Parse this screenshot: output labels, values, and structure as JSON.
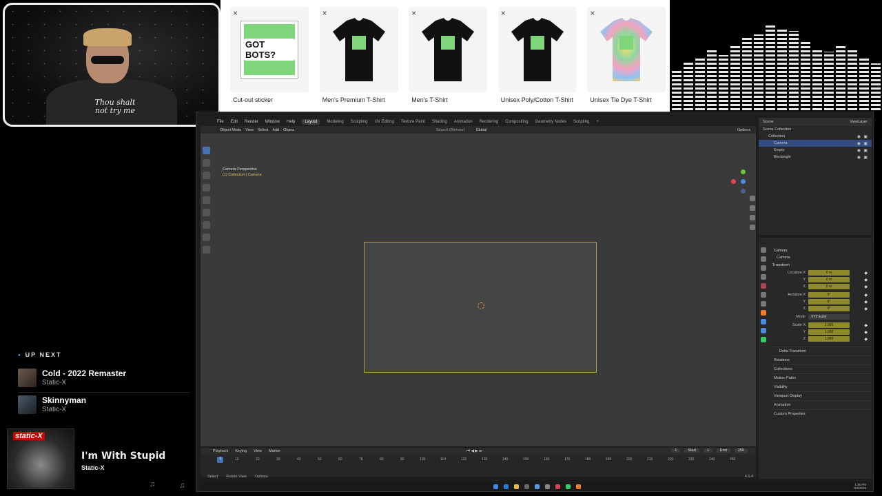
{
  "webcam": {
    "shirt_text": "Thou shalt not try me"
  },
  "merch": {
    "close_label": "×",
    "items": [
      {
        "label": "Cut-out sticker",
        "graphic_text": "GOT BOTS?",
        "kind": "sticker"
      },
      {
        "label": "Men's Premium T-Shirt",
        "kind": "tshirt-black"
      },
      {
        "label": "Men's T-Shirt",
        "kind": "tshirt-black"
      },
      {
        "label": "Unisex Poly/Cotton T-Shirt",
        "kind": "tshirt-black"
      },
      {
        "label": "Unisex Tie Dye T-Shirt",
        "kind": "tshirt-tiedye"
      }
    ],
    "colors": {
      "logo_green": "#7fd67a"
    }
  },
  "music": {
    "up_next_heading": "UP NEXT",
    "queue": [
      {
        "title": "Cold - 2022 Remaster",
        "artist": "Static-X"
      },
      {
        "title": "Skinnyman",
        "artist": "Static-X"
      }
    ],
    "now_playing": {
      "title": "I'm With Stupid",
      "artist": "Static-X",
      "logo": "static-X"
    },
    "note_icon": "♫"
  },
  "blender": {
    "menu": [
      "File",
      "Edit",
      "Render",
      "Window",
      "Help"
    ],
    "workspaces": [
      "Layout",
      "Modeling",
      "Sculpting",
      "UV Editing",
      "Texture Paint",
      "Shading",
      "Animation",
      "Rendering",
      "Compositing",
      "Geometry Nodes",
      "Scripting",
      "+"
    ],
    "active_workspace": "Layout",
    "header": {
      "mode": "Object Mode",
      "menus": [
        "View",
        "Select",
        "Add",
        "Object"
      ],
      "orientation": "Global",
      "search_placeholder": "Search (Blender)",
      "options": "Options"
    },
    "viewport": {
      "view_name": "Camera Perspective",
      "collection_path": "(1) Collection | Camera"
    },
    "timeline": {
      "menus": [
        "Playback",
        "Keying",
        "View",
        "Marker"
      ],
      "current_frame": "1",
      "ticks": [
        "10",
        "20",
        "30",
        "40",
        "50",
        "60",
        "70",
        "80",
        "90",
        "100",
        "110",
        "120",
        "130",
        "140",
        "150",
        "160",
        "170",
        "180",
        "190",
        "200",
        "210",
        "220",
        "230",
        "240",
        "250"
      ],
      "start_label": "Start",
      "start": "1",
      "end_label": "End",
      "end": "250",
      "frame_field": "1"
    },
    "status": [
      "Select",
      "Rotate View",
      "Options"
    ],
    "version": "4.5.4",
    "clock": {
      "time": "1:36 PM",
      "date": "9/4/2025"
    },
    "outliner": {
      "header": "Scene",
      "view_layer": "ViewLayer",
      "search_placeholder": "",
      "rows": [
        {
          "label": "Scene Collection",
          "indent": 0
        },
        {
          "label": "Collection",
          "indent": 1
        },
        {
          "label": "Camera",
          "indent": 2,
          "selected": true
        },
        {
          "label": "Empty",
          "indent": 2
        },
        {
          "label": "Rectangle",
          "indent": 2
        }
      ]
    },
    "properties": {
      "object": "Camera",
      "object_name_field": "Camera",
      "transform_title": "Transform",
      "location_label": "Location X",
      "location": [
        "0 m",
        "0 m",
        "0 m"
      ],
      "rotation_label": "Rotation X",
      "rotation": [
        "0°",
        "0°",
        "0°"
      ],
      "axis_y": "Y",
      "axis_z": "Z",
      "mode_label": "Mode",
      "mode_value": "XYZ Euler",
      "scale_label": "Scale X",
      "scale": [
        "1.000",
        "1.000",
        "1.000"
      ],
      "panels": [
        "Delta Transform",
        "Relations",
        "Collections",
        "Motion Paths",
        "Visibility",
        "Viewport Display",
        "Animation",
        "Custom Properties"
      ]
    }
  }
}
